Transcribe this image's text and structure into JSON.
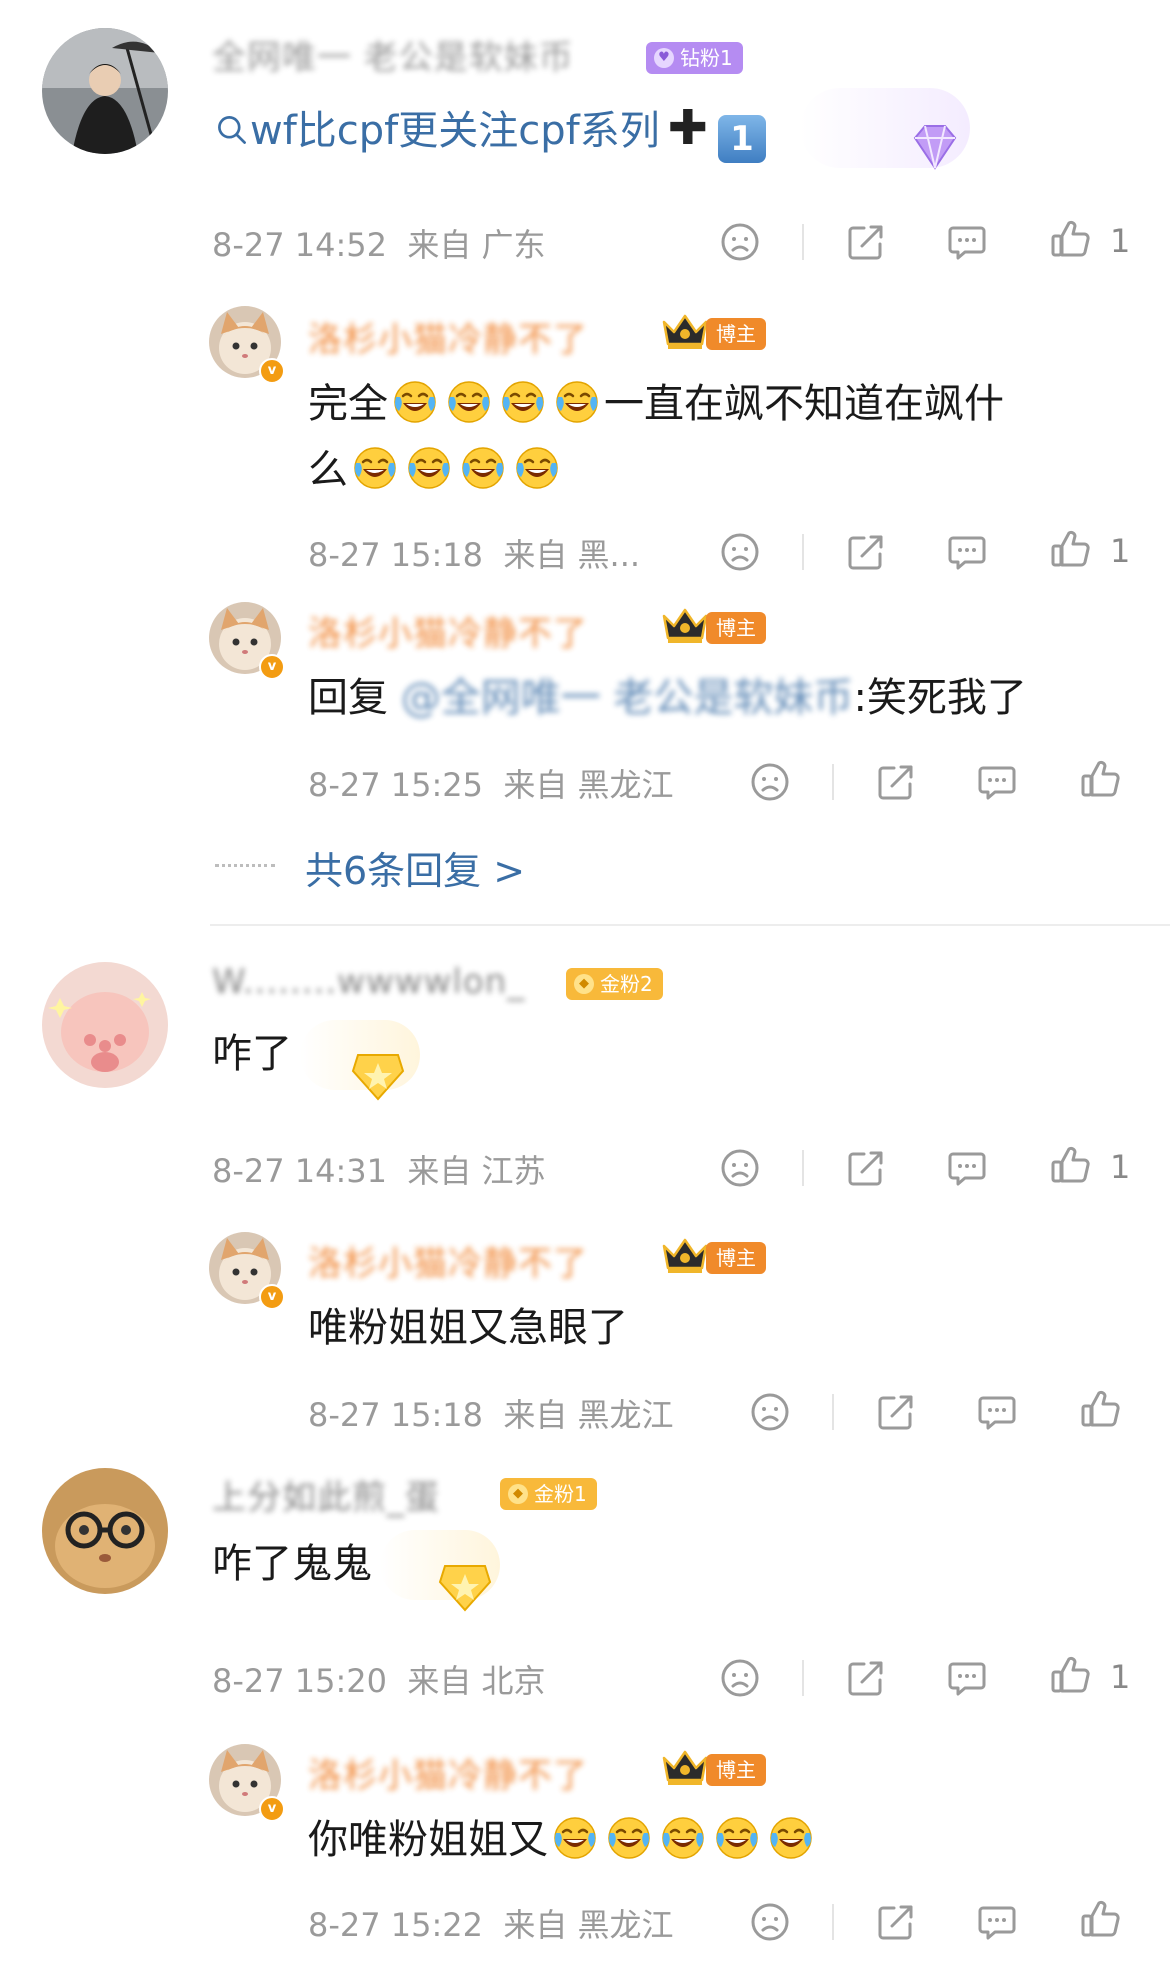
{
  "colors": {
    "link": "#3a6ea5",
    "username_blogger": "#f0812b",
    "meta_gray": "#9a9a9a",
    "badge_diamond": "#b58cf2",
    "badge_gold": "#f8b93a",
    "badge_blogger": "#f08a2a"
  },
  "comments": [
    {
      "username": "全网唯一 老公是软妹币",
      "badge": "钻粉1",
      "text_prefix_icon": "search-icon",
      "text_link": "wf比cpf更关注cpf系列",
      "text_number": "1",
      "time": "8-27 14:52",
      "location": "来自 广东",
      "like_count": "1",
      "replies": [
        {
          "username": "洛杉小猫冷静不了",
          "badge": "博主",
          "text_a": "完全",
          "text_b": "一直在飒不知道在飒什",
          "text_c": "么",
          "time": "8-27 15:18",
          "location": "来自 黑...",
          "like_count": "1"
        },
        {
          "username": "洛杉小猫冷静不了",
          "badge": "博主",
          "reply_prefix": "回复",
          "mention": "@全网唯一 老公是软妹币",
          "reply_text": ":笑死我了",
          "time": "8-27 15:25",
          "location": "来自 黑龙江"
        }
      ],
      "more_replies": "共6条回复 >"
    },
    {
      "username": "W........wwwwlon_",
      "badge": "金粉2",
      "text": "咋了",
      "time": "8-27 14:31",
      "location": "来自 江苏",
      "like_count": "1",
      "replies": [
        {
          "username": "洛杉小猫冷静不了",
          "badge": "博主",
          "text": "唯粉姐姐又急眼了",
          "time": "8-27 15:18",
          "location": "来自 黑龙江"
        }
      ]
    },
    {
      "username": "上分如此煎_蛋",
      "badge": "金粉1",
      "text": "咋了鬼鬼",
      "time": "8-27 15:20",
      "location": "来自 北京",
      "like_count": "1",
      "replies": [
        {
          "username": "洛杉小猫冷静不了",
          "badge": "博主",
          "text": "你唯粉姐姐又",
          "time": "8-27 15:22",
          "location": "来自 黑龙江"
        }
      ]
    }
  ]
}
